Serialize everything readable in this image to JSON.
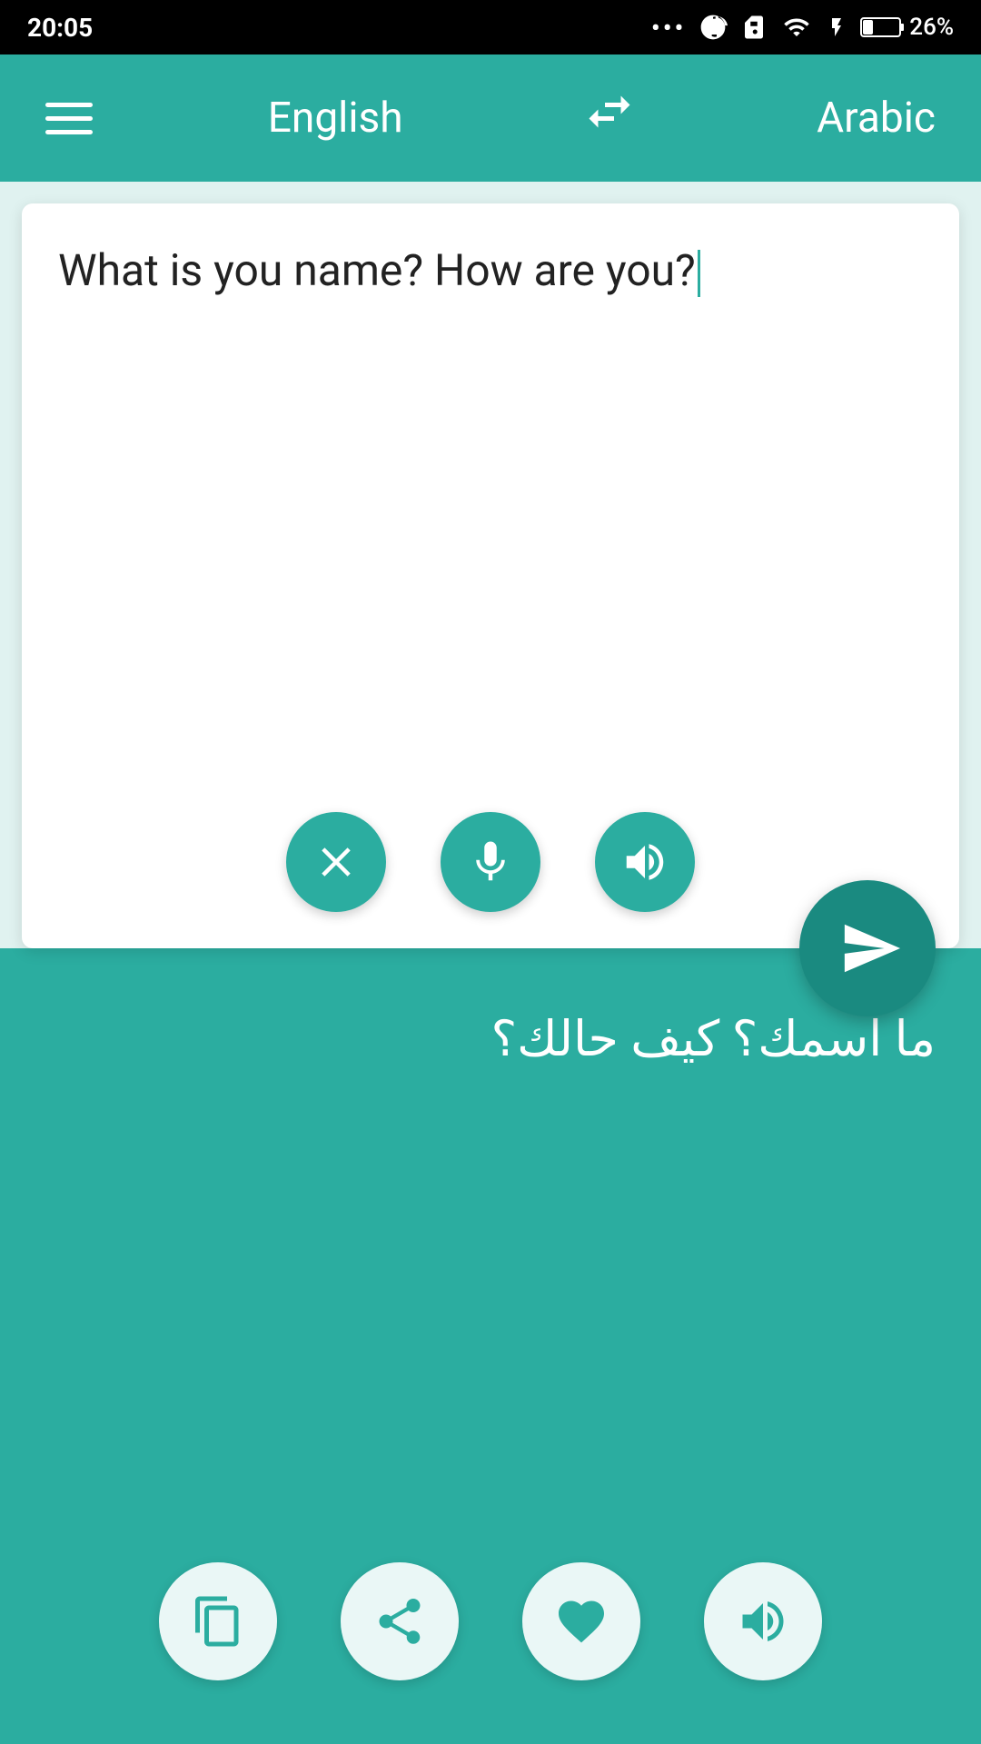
{
  "statusBar": {
    "time": "20:05",
    "battery": "26%"
  },
  "toolbar": {
    "menuIconLabel": "menu",
    "sourceLang": "English",
    "swapIconLabel": "swap languages",
    "targetLang": "Arabic"
  },
  "sourcePanel": {
    "inputText": "What is you name? How are you?",
    "clearButtonLabel": "Clear",
    "micButtonLabel": "Microphone",
    "speakerButtonLabel": "Speak source"
  },
  "sendButton": {
    "label": "Translate"
  },
  "translationPanel": {
    "translatedText": "ما اسمك؟ كيف حالك؟",
    "copyButtonLabel": "Copy",
    "shareButtonLabel": "Share",
    "favoriteButtonLabel": "Favorite",
    "speakerButtonLabel": "Speak translation"
  }
}
